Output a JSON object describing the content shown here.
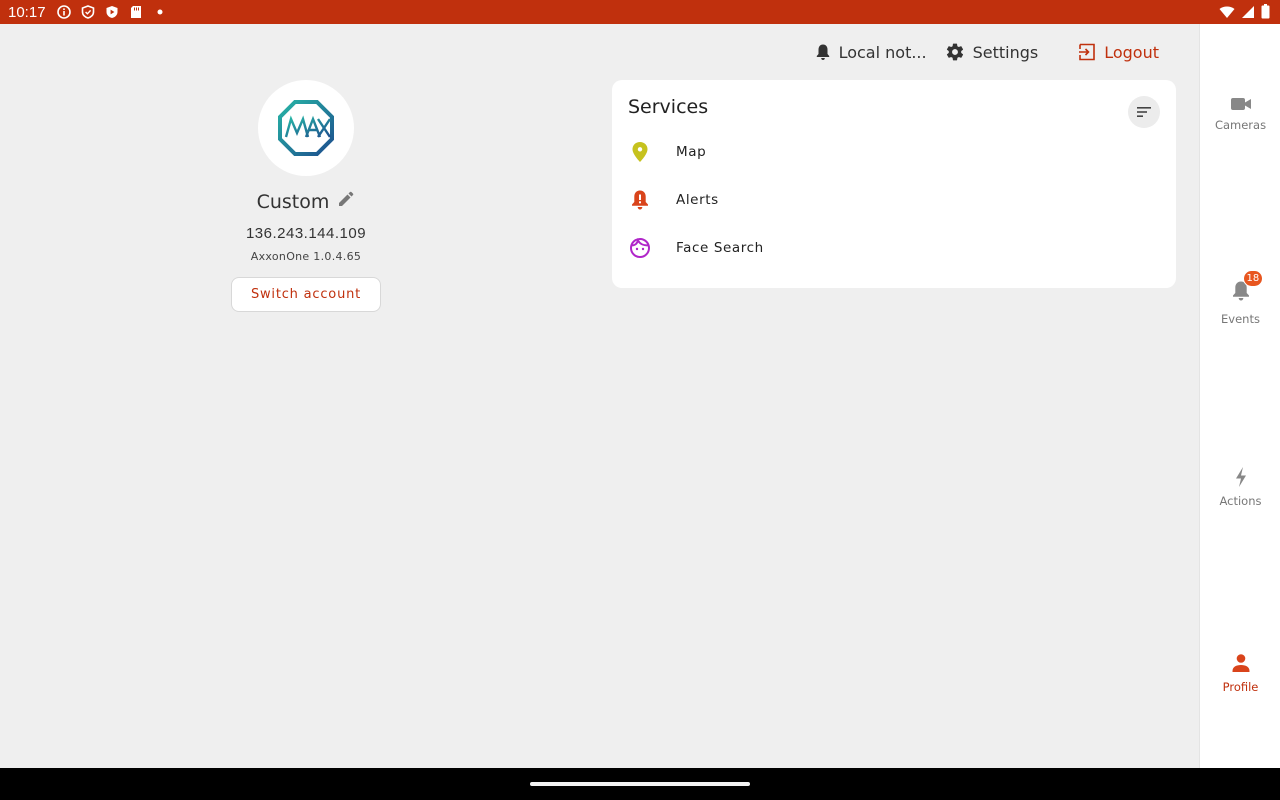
{
  "status_bar": {
    "time": "10:17"
  },
  "toolbar": {
    "notifications_label": "Local not...",
    "settings_label": "Settings",
    "logout_label": "Logout"
  },
  "profile": {
    "avatar_logo": "MAX",
    "name": "Custom",
    "ip": "136.243.144.109",
    "version": "AxxonOne 1.0.4.65",
    "switch_account_label": "Switch account"
  },
  "services": {
    "title": "Services",
    "items": [
      {
        "label": "Map",
        "icon": "map-pin-icon",
        "color": "#c6c21e"
      },
      {
        "label": "Alerts",
        "icon": "alert-bell-icon",
        "color": "#d9441b"
      },
      {
        "label": "Face Search",
        "icon": "face-icon",
        "color": "#b026c9"
      }
    ]
  },
  "nav": {
    "items": [
      {
        "label": "Cameras",
        "icon": "camera-icon"
      },
      {
        "label": "Events",
        "icon": "bell-icon",
        "badge": "18"
      },
      {
        "label": "Actions",
        "icon": "lightning-icon"
      },
      {
        "label": "Profile",
        "icon": "person-icon",
        "active": true
      }
    ]
  },
  "colors": {
    "accent": "#c0300d",
    "status_bar": "#c0300d",
    "badge": "#e8561f"
  }
}
